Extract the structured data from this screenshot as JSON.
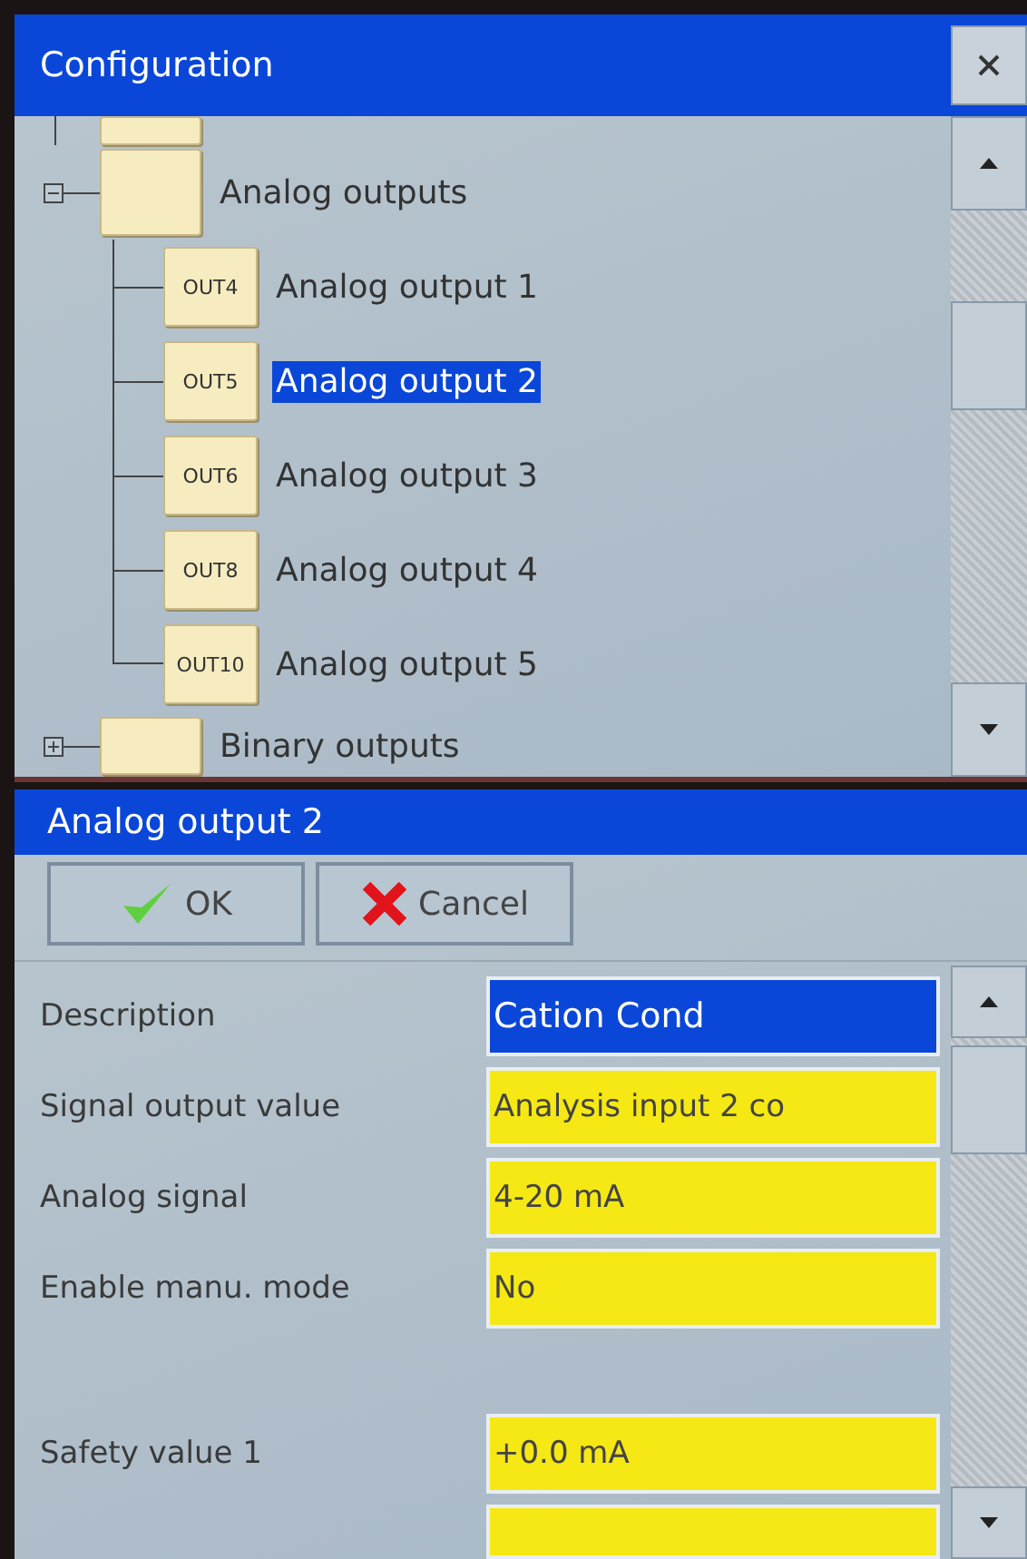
{
  "config_window": {
    "title": "Configuration",
    "tree": [
      {
        "label": "Analog outputs",
        "expanded": true,
        "children": [
          {
            "tag": "OUT4",
            "label": "Analog output 1",
            "selected": false
          },
          {
            "tag": "OUT5",
            "label": "Analog output 2",
            "selected": true
          },
          {
            "tag": "OUT6",
            "label": "Analog output 3",
            "selected": false
          },
          {
            "tag": "OUT8",
            "label": "Analog output 4",
            "selected": false
          },
          {
            "tag": "OUT10",
            "label": "Analog output 5",
            "selected": false
          }
        ]
      },
      {
        "label": "Binary outputs",
        "expanded": false
      }
    ]
  },
  "dialog": {
    "title": "Analog output 2",
    "buttons": [
      {
        "kind": "ok",
        "label": "OK"
      },
      {
        "kind": "cancel",
        "label": "Cancel"
      }
    ],
    "fields": [
      {
        "label": "Description",
        "value": "Cation Cond",
        "selected": true
      },
      {
        "label": "Signal output value",
        "value": "Analysis input 2 co",
        "selected": false
      },
      {
        "label": "Analog signal",
        "value": "4-20 mA",
        "selected": false
      },
      {
        "label": "Enable manu. mode",
        "value": "No",
        "selected": false
      },
      {
        "label": "Safety value 1",
        "value": "+0.0 mA",
        "selected": false
      }
    ]
  }
}
